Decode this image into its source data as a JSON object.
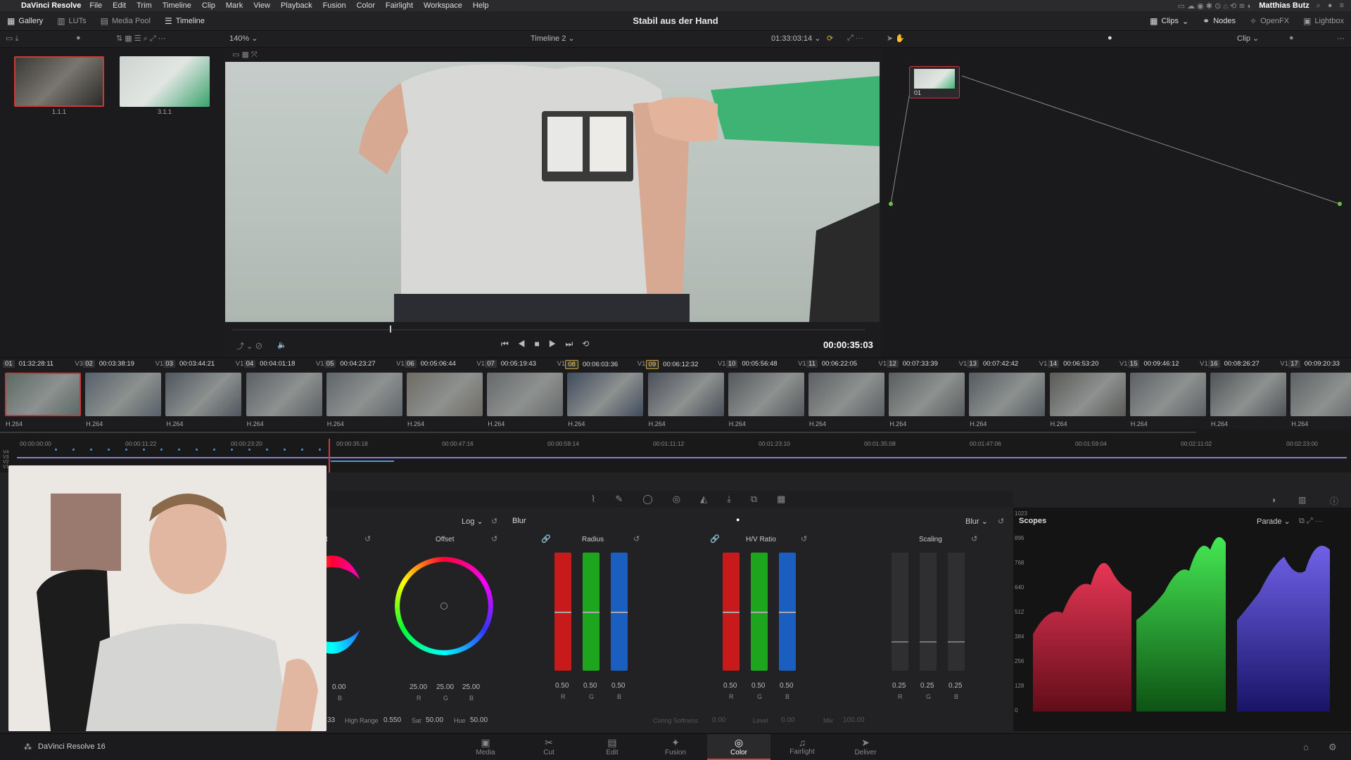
{
  "menubar": {
    "app_name": "DaVinci Resolve",
    "items": [
      "File",
      "Edit",
      "Trim",
      "Timeline",
      "Clip",
      "Mark",
      "View",
      "Playback",
      "Fusion",
      "Color",
      "Fairlight",
      "Workspace",
      "Help"
    ],
    "user": "Matthias Butz"
  },
  "toolbar": {
    "gallery": "Gallery",
    "luts": "LUTs",
    "media_pool": "Media Pool",
    "timeline": "Timeline",
    "project_title": "Stabil aus der Hand",
    "clips": "Clips",
    "nodes": "Nodes",
    "openfx": "OpenFX",
    "lightbox": "Lightbox"
  },
  "subbar": {
    "zoom": "140%",
    "timeline_name": "Timeline 2",
    "timecode": "01:33:03:14",
    "clip_mode": "Clip"
  },
  "gallery": {
    "stills": [
      {
        "label": "1.1.1"
      },
      {
        "label": "3.1.1"
      }
    ]
  },
  "viewer": {
    "current_time": "00:00:35:03"
  },
  "node": {
    "label": "01"
  },
  "clips": [
    {
      "num": "01",
      "tc": "01:32:28:11",
      "track": "V3",
      "codec": "H.264",
      "color": "#5b6a64"
    },
    {
      "num": "02",
      "tc": "00:03:38:19",
      "track": "V1",
      "codec": "H.264",
      "color": "#556069"
    },
    {
      "num": "03",
      "tc": "00:03:44:21",
      "track": "V1",
      "codec": "H.264",
      "color": "#4e565e"
    },
    {
      "num": "04",
      "tc": "00:04:01:18",
      "track": "V1",
      "codec": "H.264",
      "color": "#5a5f64"
    },
    {
      "num": "05",
      "tc": "00:04:23:27",
      "track": "V1",
      "codec": "H.264",
      "color": "#60656a"
    },
    {
      "num": "06",
      "tc": "00:05:06:44",
      "track": "V1",
      "codec": "H.264",
      "color": "#6f6a63"
    },
    {
      "num": "07",
      "tc": "00:05:19:43",
      "track": "V1",
      "codec": "H.264",
      "color": "#66696a"
    },
    {
      "num": "08",
      "tc": "00:06:03:36",
      "track": "V1",
      "codec": "H.264",
      "color": "#3f4a5c"
    },
    {
      "num": "09",
      "tc": "00:06:12:32",
      "track": "V1",
      "codec": "H.264",
      "color": "#4a4f5a"
    },
    {
      "num": "10",
      "tc": "00:05:56:48",
      "track": "V1",
      "codec": "H.264",
      "color": "#55585b"
    },
    {
      "num": "11",
      "tc": "00:06:22:05",
      "track": "V1",
      "codec": "H.264",
      "color": "#5b5f62"
    },
    {
      "num": "12",
      "tc": "00:07:33:39",
      "track": "V1",
      "codec": "H.264",
      "color": "#595d5e"
    },
    {
      "num": "13",
      "tc": "00:07:42:42",
      "track": "V1",
      "codec": "H.264",
      "color": "#545a60"
    },
    {
      "num": "14",
      "tc": "00:06:53:20",
      "track": "V1",
      "codec": "H.264",
      "color": "#5a5a58"
    },
    {
      "num": "15",
      "tc": "00:09:46:12",
      "track": "V1",
      "codec": "H.264",
      "color": "#5c6064"
    },
    {
      "num": "16",
      "tc": "00:08:26:27",
      "track": "V1",
      "codec": "H.264",
      "color": "#4f5356"
    },
    {
      "num": "17",
      "tc": "00:09:20:33",
      "track": "V1",
      "codec": "H.264",
      "color": "#5d6163"
    }
  ],
  "ruler": [
    "00:00:00:00",
    "00:00:11:22",
    "00:00:23:20",
    "00:00:35:18",
    "00:00:47:16",
    "00:00:59:14",
    "00:01:11:12",
    "00:01:23:10",
    "00:01:35:08",
    "00:01:47:06",
    "00:01:59:04",
    "00:02:11:02",
    "00:02:23:00"
  ],
  "tracks": [
    "V4",
    "V3",
    "V2",
    "V1"
  ],
  "colorwheels": {
    "mode": "Log",
    "offset_label": "Offset",
    "lift_partial_label": "t",
    "values_partial": "0.00",
    "offset_values": [
      "25.00",
      "25.00",
      "25.00"
    ],
    "high_range_label": "High Range",
    "high_range_value": "0.550",
    "sat_label": "Sat",
    "sat_value": "50.00",
    "hue_label": "Hue",
    "hue_value": "50.00",
    "partial_num": "33"
  },
  "blur": {
    "title": "Blur",
    "mode": "Blur",
    "radius_label": "Radius",
    "hv_label": "H/V Ratio",
    "scaling_label": "Scaling",
    "radius_values": [
      "0.50",
      "0.50",
      "0.50"
    ],
    "hv_values": [
      "0.50",
      "0.50",
      "0.50"
    ],
    "scaling_values": [
      "0.25",
      "0.25",
      "0.25"
    ],
    "channels": [
      "R",
      "G",
      "B"
    ],
    "radius_level": 0.5,
    "hv_level": 0.5,
    "scaling_level": 0.25,
    "coring_label": "Coring Softness",
    "coring_value": "0.00",
    "level_label": "Level",
    "level_value": "0.00",
    "mix_label": "Mix",
    "mix_value": "100.00"
  },
  "scopes": {
    "title": "Scopes",
    "mode": "Parade",
    "ticks": [
      "1023",
      "896",
      "768",
      "640",
      "512",
      "384",
      "256",
      "128",
      "0"
    ]
  },
  "pages": [
    {
      "label": "Media",
      "icon": "▣"
    },
    {
      "label": "Cut",
      "icon": "✂"
    },
    {
      "label": "Edit",
      "icon": "▤"
    },
    {
      "label": "Fusion",
      "icon": "✦"
    },
    {
      "label": "Color",
      "icon": "◎"
    },
    {
      "label": "Fairlight",
      "icon": "♫"
    },
    {
      "label": "Deliver",
      "icon": "➤"
    }
  ],
  "footer": {
    "version": "DaVinci Resolve 16"
  }
}
